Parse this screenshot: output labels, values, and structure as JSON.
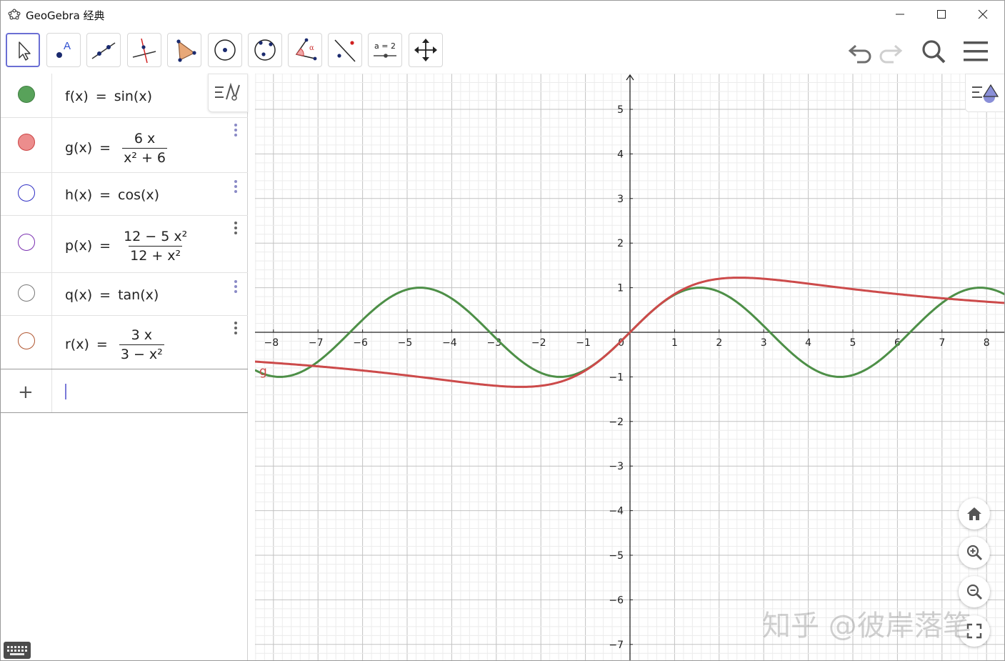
{
  "window": {
    "title": "GeoGebra 经典"
  },
  "toolbar": {
    "tools": [
      "move-tool",
      "point-tool",
      "line-tool",
      "perpendicular-tool",
      "polygon-tool",
      "circle-center-tool",
      "circle-three-points-tool",
      "angle-tool",
      "reflect-tool",
      "slider-tool",
      "move-graphics-tool"
    ],
    "slider_label": "a = 2"
  },
  "algebra": {
    "rows": [
      {
        "name": "f(x)",
        "rhs": "sin(x)",
        "color": "#4d9a52",
        "filled": true
      },
      {
        "name": "g(x)",
        "num": "6 x",
        "den": "x² + 6",
        "color": "#e06b6b",
        "filled": true
      },
      {
        "name": "h(x)",
        "rhs": "cos(x)",
        "color": "#2f2fc4",
        "filled": false
      },
      {
        "name": "p(x)",
        "num": "12 − 5 x²",
        "den": "12 + x²",
        "color": "#7a2fb0",
        "filled": false
      },
      {
        "name": "q(x)",
        "rhs": "tan(x)",
        "color": "#777777",
        "filled": false
      },
      {
        "name": "r(x)",
        "num": "3 x",
        "den": "3 − x²",
        "color": "#b0552f",
        "filled": false
      }
    ],
    "equals": "="
  },
  "graphics": {
    "curve_label": "g",
    "watermark": "知乎 @彼岸落笔",
    "x_ticks": [
      "−8",
      "−7",
      "−6",
      "−5",
      "−4",
      "−3",
      "−2",
      "−1",
      "1",
      "2",
      "3",
      "4",
      "5",
      "6",
      "7",
      "8"
    ],
    "y_ticks": [
      "5",
      "4",
      "3",
      "2",
      "1",
      "−1",
      "−2",
      "−3",
      "−4",
      "−5",
      "−6",
      "−7"
    ],
    "origin_label": "0"
  },
  "chart_data": {
    "type": "line",
    "xlim": [
      -8.4,
      8.4
    ],
    "ylim": [
      -7.3,
      5.8
    ],
    "grid": true,
    "series": [
      {
        "function": "sin(x)",
        "color": "#4d8f47"
      },
      {
        "function": "6x/(x^2+6)",
        "color": "#cc4a4a"
      }
    ]
  }
}
